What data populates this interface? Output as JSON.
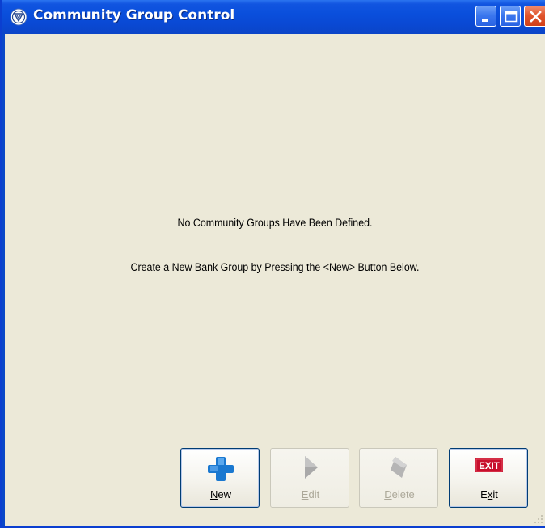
{
  "window": {
    "title": "Community Group Control"
  },
  "content": {
    "message_line1": "No Community Groups Have Been Defined.",
    "message_line2": "Create a New Bank Group by Pressing the <New> Button Below."
  },
  "buttons": {
    "new": {
      "label_accel": "N",
      "label_rest": "ew",
      "enabled": true,
      "icon": "blue-plus-icon"
    },
    "edit": {
      "label_accel": "E",
      "label_rest": "dit",
      "enabled": false,
      "icon": "play-arrow-icon"
    },
    "delete": {
      "label_accel": "D",
      "label_rest": "elete",
      "enabled": false,
      "icon": "eraser-icon"
    },
    "exit": {
      "label_pre": "E",
      "label_accel": "x",
      "label_rest": "it",
      "enabled": true,
      "icon": "exit-sign-icon",
      "icon_text": "EXIT"
    }
  },
  "colors": {
    "titlebar": "#0a4fdc",
    "client_bg": "#ece9d8",
    "close_button": "#e0552c",
    "plus_icon": "#1a78d0",
    "exit_sign": "#c8102e"
  }
}
